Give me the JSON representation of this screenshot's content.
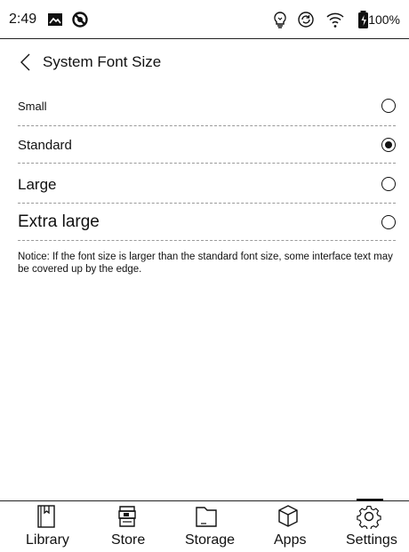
{
  "status_bar": {
    "time": "2:49",
    "battery": "100%",
    "left_icons": [
      "image-icon",
      "sync-disabled-icon"
    ],
    "right_icons": [
      "lightbulb-icon",
      "refresh-icon",
      "wifi-icon",
      "battery-icon"
    ]
  },
  "header": {
    "title": "System Font Size",
    "back_icon": "chevron-left-icon"
  },
  "options": [
    {
      "label": "Small",
      "selected": false
    },
    {
      "label": "Standard",
      "selected": true
    },
    {
      "label": "Large",
      "selected": false
    },
    {
      "label": "Extra large",
      "selected": false
    }
  ],
  "notice": "Notice: If the font size is larger than the standard font size, some interface text may be covered up by the edge.",
  "bottom_nav": {
    "items": [
      {
        "label": "Library",
        "icon": "book-icon"
      },
      {
        "label": "Store",
        "icon": "store-icon"
      },
      {
        "label": "Storage",
        "icon": "folder-icon"
      },
      {
        "label": "Apps",
        "icon": "cube-icon"
      },
      {
        "label": "Settings",
        "icon": "gear-icon"
      }
    ],
    "active": "Settings"
  }
}
